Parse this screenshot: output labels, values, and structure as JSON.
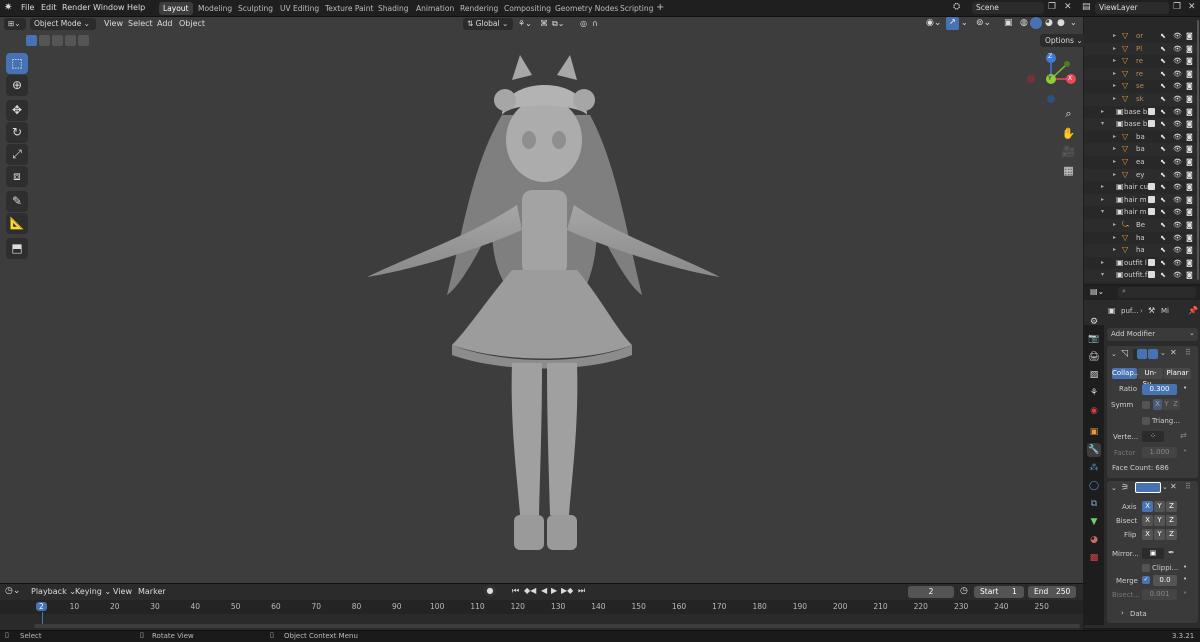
{
  "menu": [
    "File",
    "Edit",
    "Render",
    "Window",
    "Help"
  ],
  "workspaces": [
    "Layout",
    "Modeling",
    "Sculpting",
    "UV Editing",
    "Texture Paint",
    "Shading",
    "Animation",
    "Rendering",
    "Compositing",
    "Geometry Nodes",
    "Scripting"
  ],
  "active_workspace": "Layout",
  "add_workspace": "+",
  "scene_name": "Scene",
  "view_layer": "ViewLayer",
  "viewport_header": {
    "mode": "Object Mode",
    "menus": [
      "View",
      "Select",
      "Add",
      "Object"
    ],
    "orientation": "Global",
    "options": "Options"
  },
  "toolbar_icons": [
    "select-box-icon",
    "cursor-icon",
    "move-icon",
    "rotate-icon",
    "scale-icon",
    "transform-icon",
    "annotate-icon",
    "measure-icon",
    "add-cube-icon"
  ],
  "gizmo": {
    "x": "X",
    "y": "Y",
    "z": "Z"
  },
  "outliner": {
    "rows": [
      {
        "name": "or",
        "kind": "mesh",
        "indent": 3
      },
      {
        "name": "Pl",
        "kind": "mesh",
        "indent": 3
      },
      {
        "name": "re",
        "kind": "mesh",
        "indent": 3
      },
      {
        "name": "re",
        "kind": "mesh",
        "indent": 3
      },
      {
        "name": "se",
        "kind": "mesh",
        "indent": 3
      },
      {
        "name": "sk",
        "kind": "mesh",
        "indent": 3
      },
      {
        "name": "base b",
        "kind": "collection",
        "indent": 1
      },
      {
        "name": "base b",
        "kind": "collection",
        "indent": 1
      },
      {
        "name": "ba",
        "kind": "mesh",
        "indent": 2
      },
      {
        "name": "ba",
        "kind": "mesh",
        "indent": 2
      },
      {
        "name": "ea",
        "kind": "mesh",
        "indent": 2
      },
      {
        "name": "ey",
        "kind": "mesh",
        "indent": 2
      },
      {
        "name": "hair cu",
        "kind": "collection",
        "indent": 1
      },
      {
        "name": "hair m",
        "kind": "collection",
        "indent": 1
      },
      {
        "name": "hair m",
        "kind": "collection",
        "indent": 1
      },
      {
        "name": "Be",
        "kind": "curve",
        "indent": 2
      },
      {
        "name": "ha",
        "kind": "mesh",
        "indent": 2
      },
      {
        "name": "ha",
        "kind": "mesh",
        "indent": 2
      },
      {
        "name": "outfit l",
        "kind": "collection",
        "indent": 1
      },
      {
        "name": "outfit.f",
        "kind": "collection",
        "indent": 1
      }
    ]
  },
  "properties": {
    "search_placeholder": "",
    "object_name": "puf...",
    "modifier_name": "Mi",
    "add_modifier": "Add Modifier",
    "decimate": {
      "modes": [
        "Collap...",
        "Un-Su...",
        "Planar"
      ],
      "ratio_label": "Ratio",
      "ratio_value": "0.300",
      "symm_label": "Symm",
      "axes": [
        "X",
        "Y",
        "Z"
      ],
      "triangulate": "Triang...",
      "vertex_label": "Verte...",
      "factor_label": "Factor",
      "factor_value": "1.000",
      "face_count": "Face Count: 686"
    },
    "mirror": {
      "axis_label": "Axis",
      "bisect_label": "Bisect",
      "flip_label": "Flip",
      "axes": [
        "X",
        "Y",
        "Z"
      ],
      "mirror_obj_label": "Mirror...",
      "clipping_label": "Clippi...",
      "merge_label": "Merge",
      "merge_value": "0.0",
      "bisect_dist_label": "Bisect...",
      "bisect_dist_value": "0.001",
      "data_label": "Data"
    }
  },
  "timeline": {
    "menus": [
      "Playback",
      "Keying",
      "View",
      "Marker"
    ],
    "current_frame": "2",
    "start_label": "Start",
    "start_value": "1",
    "end_label": "End",
    "end_value": "250",
    "ticks": [
      "2",
      "10",
      "20",
      "30",
      "40",
      "50",
      "60",
      "70",
      "80",
      "90",
      "100",
      "110",
      "120",
      "130",
      "140",
      "150",
      "160",
      "170",
      "180",
      "190",
      "200",
      "210",
      "220",
      "230",
      "240",
      "250"
    ]
  },
  "status": {
    "select": "Select",
    "rotate": "Rotate View",
    "context": "Object Context Menu",
    "version": "3.3.21"
  }
}
